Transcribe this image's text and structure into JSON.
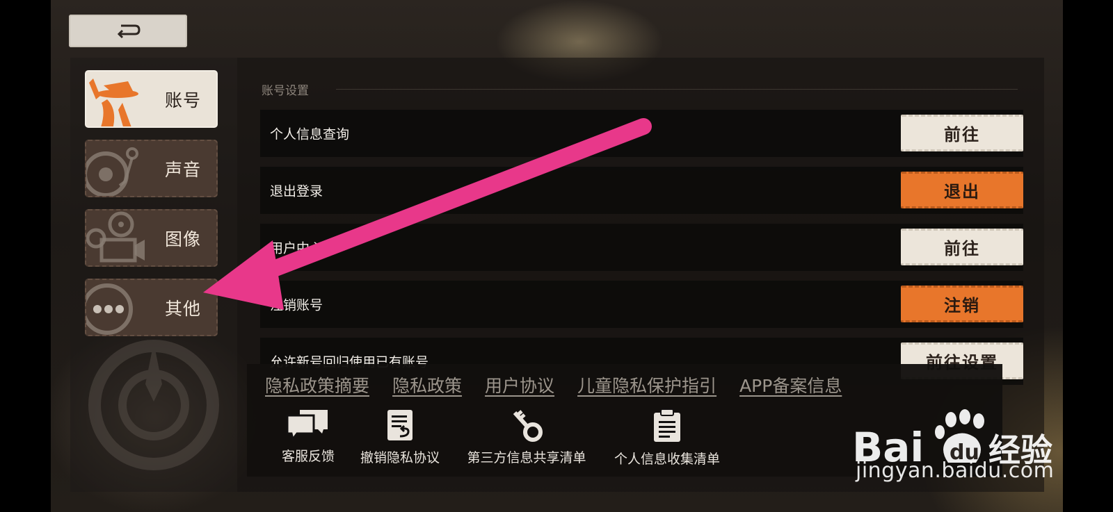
{
  "back_button": {
    "icon": "return-arrow-icon"
  },
  "sidebar": {
    "tabs": [
      {
        "label": "账号",
        "active": true,
        "icon": "detective-avatar-icon"
      },
      {
        "label": "声音",
        "active": false,
        "icon": "record-player-icon"
      },
      {
        "label": "图像",
        "active": false,
        "icon": "film-camera-icon"
      },
      {
        "label": "其他",
        "active": false,
        "icon": "more-dots-icon"
      }
    ]
  },
  "main": {
    "section_title": "账号设置",
    "rows": [
      {
        "label": "个人信息查询",
        "button": "前往",
        "style": "light"
      },
      {
        "label": "退出登录",
        "button": "退出",
        "style": "orange"
      },
      {
        "label": "用户中心",
        "button": "前往",
        "style": "light"
      },
      {
        "label": "注销账号",
        "button": "注销",
        "style": "orange"
      },
      {
        "label": "允许新号回归使用已有账号",
        "button": "前往设置",
        "style": "light"
      }
    ]
  },
  "footer": {
    "links": [
      "隐私政策摘要",
      "隐私政策",
      "用户协议",
      "儿童隐私保护指引",
      "APP备案信息"
    ],
    "icons": [
      {
        "label": "客服反馈",
        "icon": "chat-bubbles-icon"
      },
      {
        "label": "撤销隐私协议",
        "icon": "revoke-document-icon"
      },
      {
        "label": "第三方信息共享清单",
        "icon": "key-icon"
      },
      {
        "label": "个人信息收集清单",
        "icon": "clipboard-icon"
      }
    ]
  },
  "watermark": {
    "brand": "Bai du 经验",
    "url": "jingyan.baidu.com"
  },
  "colors": {
    "accent_orange": "#e8762b",
    "light_button": "#ece5da",
    "annotation_arrow": "#e8388a"
  }
}
